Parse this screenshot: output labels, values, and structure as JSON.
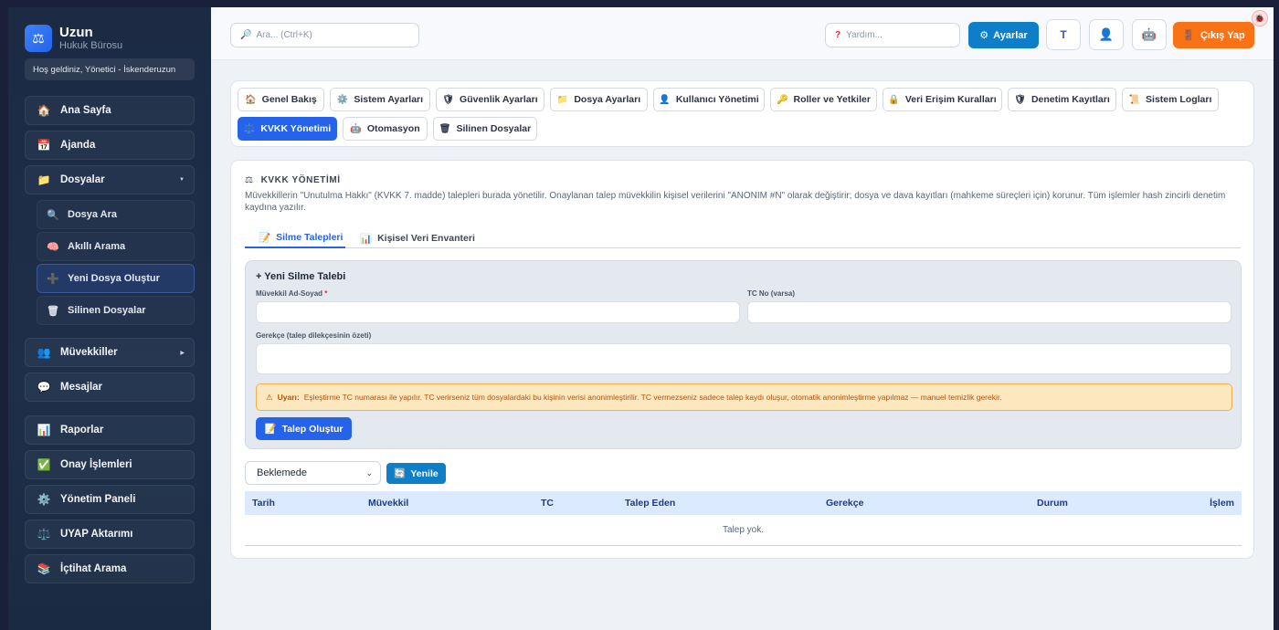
{
  "sidebar": {
    "brand_title": "Uzun",
    "brand_subtitle": "Hukuk Bürosu",
    "brand_icon": "scales-icon",
    "welcome": "Hoş geldiniz, Yönetici - İskenderuzun",
    "items": [
      {
        "label": "Ana Sayfa",
        "icon": "🏠"
      },
      {
        "label": "Ajanda",
        "icon": "📅"
      },
      {
        "label": "Dosyalar",
        "icon": "📁",
        "expanded": true
      },
      {
        "label": "Müvekkiller",
        "icon": "👥"
      },
      {
        "label": "Mesajlar",
        "icon": "💬"
      },
      {
        "label": "Raporlar",
        "icon": "📊"
      },
      {
        "label": "Onay İşlemleri",
        "icon": "✅"
      },
      {
        "label": "Yönetim Paneli",
        "icon": "⚙️"
      },
      {
        "label": "UYAP Aktarımı",
        "icon": "⚖️"
      },
      {
        "label": "İçtihat Arama",
        "icon": "📚"
      }
    ],
    "dosyalar_sub": [
      {
        "label": "Dosya Ara",
        "icon": "🔍"
      },
      {
        "label": "Akıllı Arama",
        "icon": "🧠"
      },
      {
        "label": "Yeni Dosya Oluştur",
        "icon": "➕",
        "active": true
      },
      {
        "label": "Silinen Dosyalar",
        "icon": "🗑"
      }
    ]
  },
  "topbar": {
    "search_placeholder": "Ara... (Ctrl+K)",
    "help_placeholder": "Yardım...",
    "settings_label": "Ayarlar",
    "logout_label": "Çıkış Yap"
  },
  "admin_tabs": [
    {
      "label": "Genel Bakış",
      "icon": "🏠"
    },
    {
      "label": "Sistem Ayarları",
      "icon": "⚙️"
    },
    {
      "label": "Güvenlik Ayarları",
      "icon": "🛡"
    },
    {
      "label": "Dosya Ayarları",
      "icon": "📁"
    },
    {
      "label": "Kullanıcı Yönetimi",
      "icon": "👤"
    },
    {
      "label": "Roller ve Yetkiler",
      "icon": "🔑"
    },
    {
      "label": "Veri Erişim Kuralları",
      "icon": "🔒"
    },
    {
      "label": "Denetim Kayıtları",
      "icon": "🛡"
    },
    {
      "label": "Sistem Logları",
      "icon": "📜"
    },
    {
      "label": "KVKK Yönetimi",
      "icon": "⚖️",
      "active": true
    },
    {
      "label": "Otomasyon",
      "icon": "🤖"
    },
    {
      "label": "Silinen Dosyalar",
      "icon": "🗑"
    }
  ],
  "kvkk": {
    "title": "KVKK YÖNETİMİ",
    "description": "Müvekkillerin \"Unutulma Hakkı\" (KVKK 7. madde) talepleri burada yönetilir. Onaylanan talep müvekkilin kişisel verilerini \"ANONIM #N\" olarak değiştirir; dosya ve dava kayıtları (mahkeme süreçleri için) korunur. Tüm işlemler hash zincirli denetim kaydına yazılır.",
    "subtabs": [
      {
        "label": "Silme Talepleri",
        "icon": "📝",
        "active": true
      },
      {
        "label": "Kişisel Veri Envanteri",
        "icon": "📊"
      }
    ],
    "form": {
      "title": "+ Yeni Silme Talebi",
      "name_label": "Müvekkil Ad-Soyad",
      "required_mark": "*",
      "tc_label": "TC No (varsa)",
      "reason_label": "Gerekçe (talep dilekçesinin özeti)",
      "warning_bold": "Uyarı:",
      "warning_text": "Eşleştirme TC numarası ile yapılır. TC verirseniz tüm dosyalardaki bu kişinin verisi anonimleştirilir. TC vermezseniz sadece talep kaydı oluşur, otomatik anonimleştirme yapılmaz — manuel temizlik gerekir.",
      "submit_label": "Talep Oluştur"
    },
    "filter_selected": "Beklemede",
    "refresh_label": "Yenile",
    "table": {
      "columns": [
        "Tarih",
        "Müvekkil",
        "TC",
        "Talep Eden",
        "Gerekçe",
        "Durum",
        "İşlem"
      ],
      "empty_text": "Talep yok."
    }
  },
  "colors": {
    "primary": "#2563eb",
    "info": "#0e7ec9",
    "logout": "#f97316",
    "sidebar_bg": "#1c2a44",
    "warning_bg": "#fde7bf"
  }
}
